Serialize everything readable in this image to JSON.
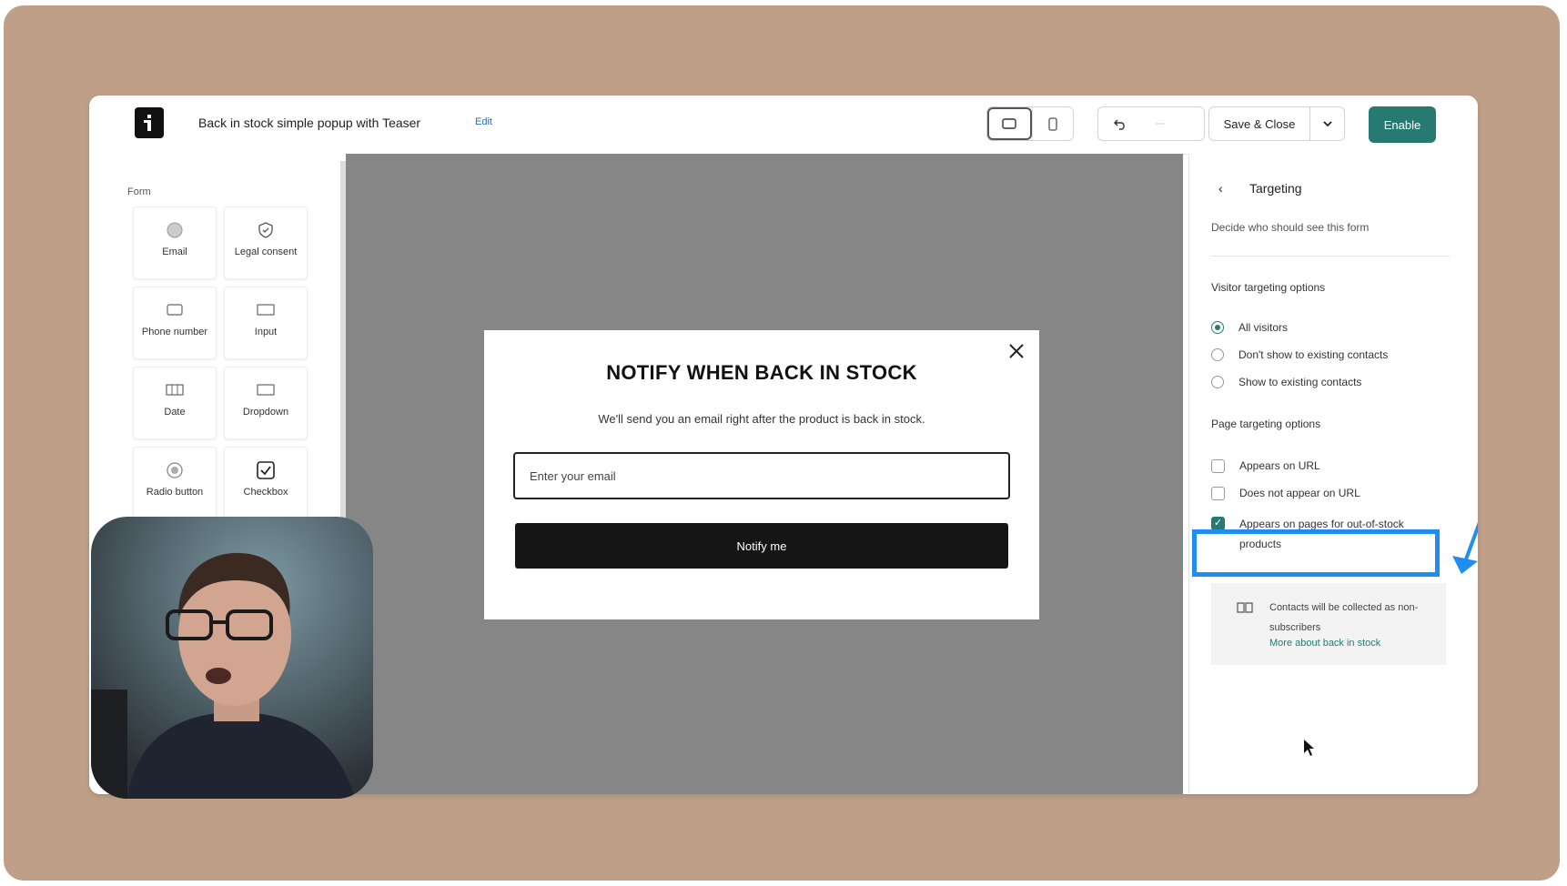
{
  "header": {
    "title": "Back in stock simple popup with Teaser",
    "edit_label": "Edit",
    "save_label": "Save & Close",
    "enable_label": "Enable"
  },
  "left_panel": {
    "section_label": "Form",
    "tiles": [
      {
        "label": "Email",
        "icon": "email-icon"
      },
      {
        "label": "Legal consent",
        "icon": "shield-icon"
      },
      {
        "label": "Phone number",
        "icon": "phone-icon"
      },
      {
        "label": "Input",
        "icon": "input-icon"
      },
      {
        "label": "Date",
        "icon": "calendar-icon"
      },
      {
        "label": "Dropdown",
        "icon": "dropdown-icon"
      },
      {
        "label": "Radio button",
        "icon": "radio-icon"
      },
      {
        "label": "Checkbox",
        "icon": "checkbox-icon"
      }
    ]
  },
  "popup": {
    "title": "NOTIFY WHEN BACK IN STOCK",
    "subtitle": "We'll send you an email right after the product is back in stock.",
    "input_placeholder": "Enter your email",
    "button_label": "Notify me"
  },
  "right_panel": {
    "back": "‹",
    "title": "Targeting",
    "description": "Decide who should see this form",
    "visitor_heading": "Visitor targeting options",
    "visitor_options": [
      {
        "label": "All visitors",
        "selected": true
      },
      {
        "label": "Don't show to existing contacts",
        "selected": false
      },
      {
        "label": "Show to existing contacts",
        "selected": false
      }
    ],
    "page_heading": "Page targeting options",
    "page_options": [
      {
        "label": "Appears on URL",
        "checked": false
      },
      {
        "label": "Does not appear on URL",
        "checked": false
      },
      {
        "label": "Appears on pages for out-of-stock products",
        "checked": true
      }
    ],
    "info_text": "Contacts will be collected as non-subscribers",
    "info_link": "More about back in stock"
  },
  "colors": {
    "accent": "#277a71",
    "highlight": "#1f8ef0",
    "frame": "#bf9f87",
    "canvas": "#868686"
  }
}
